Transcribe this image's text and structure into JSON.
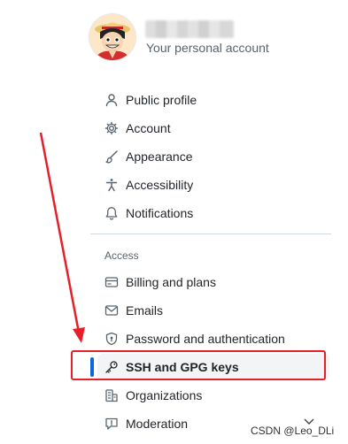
{
  "profile": {
    "username": "·········",
    "subtitle": "Your personal account"
  },
  "nav": {
    "items": [
      {
        "label": "Public profile",
        "icon": "person-icon"
      },
      {
        "label": "Account",
        "icon": "gear-icon"
      },
      {
        "label": "Appearance",
        "icon": "paintbrush-icon"
      },
      {
        "label": "Accessibility",
        "icon": "accessibility-icon"
      },
      {
        "label": "Notifications",
        "icon": "bell-icon"
      }
    ],
    "access_heading": "Access",
    "access_items": [
      {
        "label": "Billing and plans",
        "icon": "credit-card-icon"
      },
      {
        "label": "Emails",
        "icon": "mail-icon"
      },
      {
        "label": "Password and authentication",
        "icon": "shield-lock-icon"
      },
      {
        "label": "SSH and GPG keys",
        "icon": "key-icon",
        "selected": true
      },
      {
        "label": "Organizations",
        "icon": "organization-icon"
      },
      {
        "label": "Moderation",
        "icon": "report-icon"
      }
    ]
  },
  "annotation": {
    "color": "#e5202a"
  },
  "colors": {
    "accent": "#0969da",
    "text": "#1f2328",
    "muted": "#59636e",
    "divider": "#d1d9e0"
  },
  "watermark": "CSDN @Leo_DLi"
}
